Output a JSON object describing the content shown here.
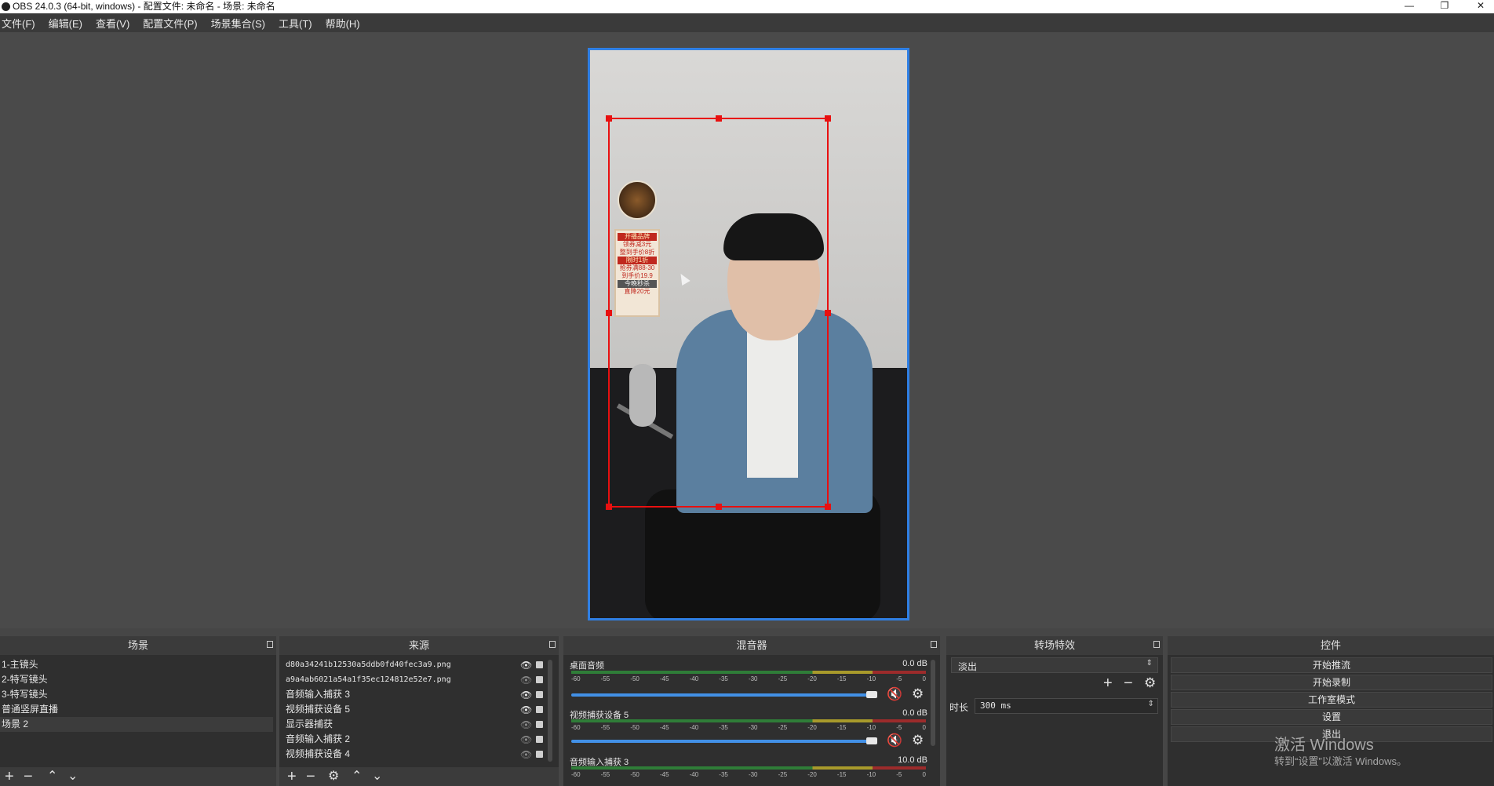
{
  "window": {
    "title": "OBS 24.0.3 (64-bit, windows) - 配置文件: 未命名 - 场景: 未命名",
    "minimize_glyph": "—",
    "restore_glyph": "❐",
    "close_glyph": "✕"
  },
  "menu": [
    "文件(F)",
    "编辑(E)",
    "查看(V)",
    "配置文件(P)",
    "场景集合(S)",
    "工具(T)",
    "帮助(H)"
  ],
  "preview": {
    "promo_lines": [
      "开播品牌",
      "领券减3元",
      "整到手价8折",
      "限时1折",
      "抢券满88-30",
      "到手价19.9",
      "今晚秒杀",
      "直降20元"
    ]
  },
  "scenes": {
    "title": "场景",
    "items": [
      "1-主镜头",
      "2-特写镜头",
      "3-特写镜头",
      "普通竖屏直播",
      "场景 2"
    ],
    "selected_index": 4
  },
  "sources": {
    "title": "来源",
    "items": [
      {
        "name": "d80a34241b12530a5ddb0fd40fec3a9.png",
        "visible": true,
        "locked": true
      },
      {
        "name": "a9a4ab6021a54a1f35ec124812e52e7.png",
        "visible": false,
        "locked": true
      },
      {
        "name": "音频输入捕获 3",
        "visible": true,
        "locked": true
      },
      {
        "name": "视频捕获设备 5",
        "visible": true,
        "locked": true
      },
      {
        "name": "显示器捕获",
        "visible": false,
        "locked": true
      },
      {
        "name": "音频输入捕获 2",
        "visible": false,
        "locked": true
      },
      {
        "name": "视频捕获设备 4",
        "visible": false,
        "locked": true
      }
    ]
  },
  "mixer": {
    "title": "混音器",
    "ticks": [
      "-60",
      "-55",
      "-50",
      "-45",
      "-40",
      "-35",
      "-30",
      "-25",
      "-20",
      "-15",
      "-10",
      "-5",
      "0"
    ],
    "channels": [
      {
        "name": "桌面音频",
        "db": "0.0 dB",
        "volume": 1.0
      },
      {
        "name": "视频捕获设备 5",
        "db": "0.0 dB",
        "volume": 1.0
      },
      {
        "name": "音频输入捕获 3",
        "db": "10.0 dB",
        "volume": 1.0
      }
    ]
  },
  "transitions": {
    "title": "转场特效",
    "selected": "淡出",
    "duration_label": "时长",
    "duration_value": "300 ms"
  },
  "controls": {
    "title": "控件",
    "buttons": [
      "开始推流",
      "开始录制",
      "工作室模式",
      "设置",
      "退出"
    ]
  },
  "watermark": {
    "line1": "激活 Windows",
    "line2": "转到“设置”以激活 Windows。"
  },
  "colors": {
    "selection_border": "#e81010",
    "canvas_border": "#2f7fe4",
    "volume_slider": "#4290e6",
    "mute": "#e33333"
  }
}
